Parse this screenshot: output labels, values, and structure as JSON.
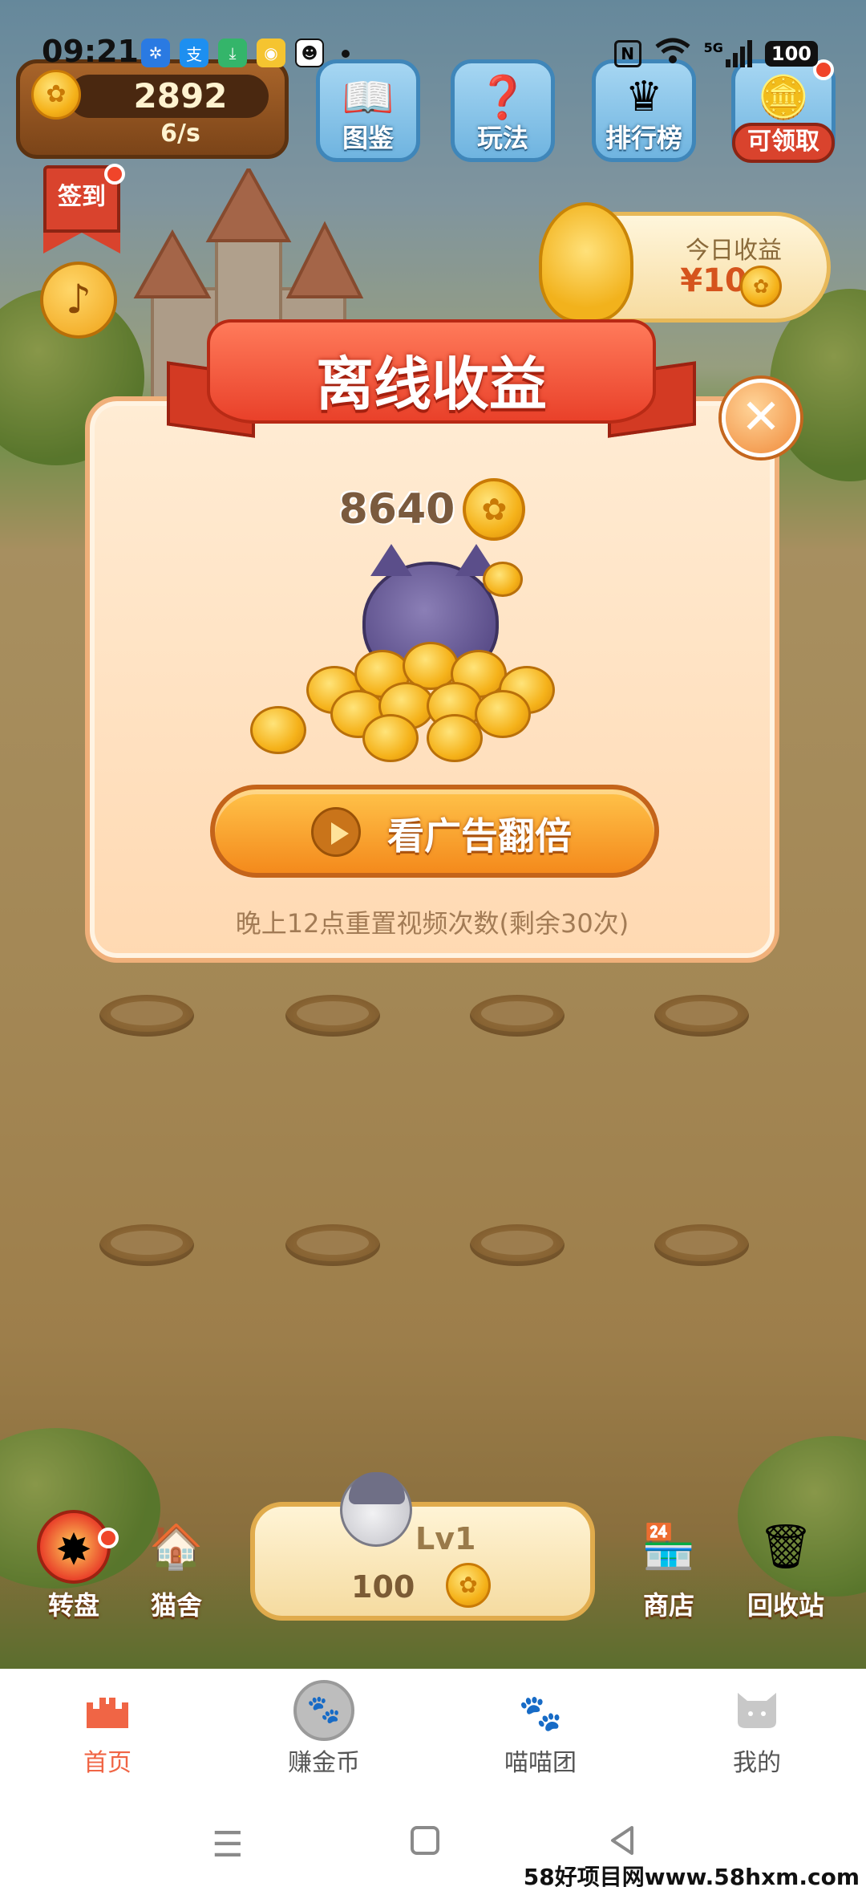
{
  "status_bar": {
    "time": "09:21",
    "battery": "100",
    "network": "5G",
    "signal_sub": "6"
  },
  "hud": {
    "coins_total": "2892",
    "coins_rate": "6/s",
    "buttons": [
      {
        "label": "图鉴",
        "icon": "book-icon"
      },
      {
        "label": "玩法",
        "icon": "question-book-icon"
      },
      {
        "label": "排行榜",
        "icon": "crown-icon"
      },
      {
        "label": "可领取",
        "icon": "paw-coin-icon"
      }
    ],
    "sign_in": "签到",
    "today_income": {
      "label": "今日收益",
      "value": "¥10"
    }
  },
  "modal": {
    "title": "离线收益",
    "reward_amount": "8640",
    "ad_button": "看广告翻倍",
    "note": "晚上12点重置视频次数(剩余30次)"
  },
  "dock": {
    "left": [
      {
        "label": "转盘",
        "icon": "wheel-icon"
      },
      {
        "label": "猫舍",
        "icon": "cat-house-icon"
      }
    ],
    "right": [
      {
        "label": "商店",
        "icon": "shop-icon"
      },
      {
        "label": "回收站",
        "icon": "recycle-bin-icon"
      }
    ],
    "level": {
      "label": "Lv1",
      "price": "100"
    }
  },
  "tabs": [
    {
      "label": "首页",
      "icon": "castle-icon",
      "active": true
    },
    {
      "label": "赚金币",
      "icon": "paw-coin-icon",
      "active": false
    },
    {
      "label": "喵喵团",
      "icon": "paws-icon",
      "active": false
    },
    {
      "label": "我的",
      "icon": "cat-face-icon",
      "active": false
    }
  ],
  "watermark": "58好项目网www.58hxm.com",
  "colors": {
    "accent": "#f06545",
    "button_orange": "#f48a1c",
    "ribbon_red": "#e9412a",
    "coin_gold": "#f5b21a"
  }
}
